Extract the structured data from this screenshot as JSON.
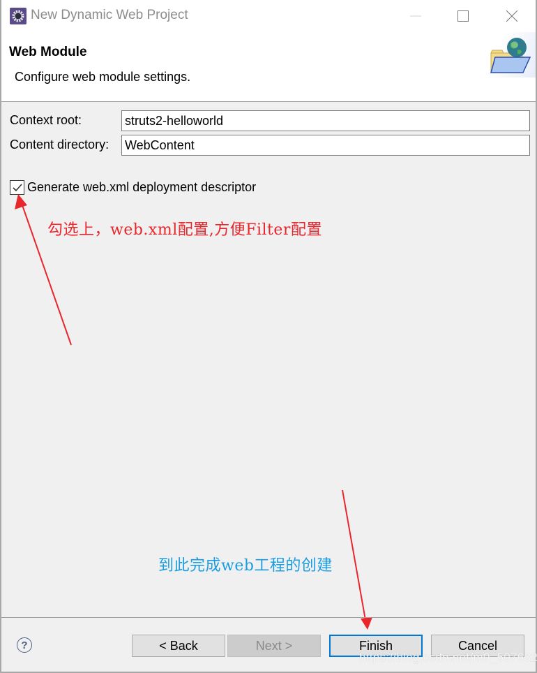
{
  "window": {
    "title": "New Dynamic Web Project",
    "app_icon": "eclipse-gear-icon",
    "controls": [
      "minimize",
      "maximize",
      "close"
    ]
  },
  "header": {
    "title": "Web Module",
    "description": "Configure web module settings.",
    "image": "folder-globe-icon"
  },
  "form": {
    "context_root": {
      "label": "Context root:",
      "value": "struts2-helloworld"
    },
    "content_directory": {
      "label": "Content directory:",
      "value": "WebContent"
    },
    "generate_descriptor": {
      "label": "Generate web.xml deployment descriptor",
      "checked": true
    }
  },
  "annotations": {
    "checkbox_note": "勾选上，web.xml配置,方便Filter配置",
    "finish_note": "到此完成web工程的创建",
    "checkbox_note_color": "#e8262c",
    "finish_note_color": "#1a9de0",
    "arrow_color": "#e8262c"
  },
  "footer": {
    "help_label": "?",
    "buttons": {
      "back": {
        "label": "< Back",
        "enabled": true
      },
      "next": {
        "label": "Next >",
        "enabled": false
      },
      "finish": {
        "label": "Finish",
        "enabled": true,
        "default": true
      },
      "cancel": {
        "label": "Cancel",
        "enabled": true
      }
    }
  },
  "watermark": "https://blog.csdn.net/m0_50763265"
}
